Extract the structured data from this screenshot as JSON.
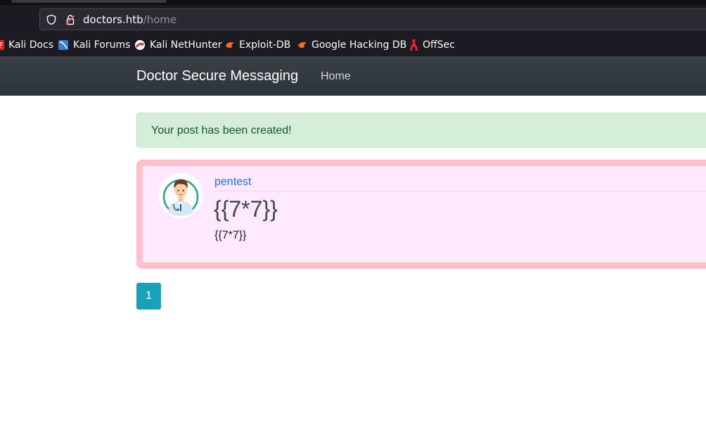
{
  "browser": {
    "url_host": "doctors.htb",
    "url_path": "/home",
    "bookmarks": [
      {
        "label": "Kali Docs",
        "icon": "kali-docs-icon"
      },
      {
        "label": "Kali Forums",
        "icon": "kali-forums-icon"
      },
      {
        "label": "Kali NetHunter",
        "icon": "kali-nethunter-icon"
      },
      {
        "label": "Exploit-DB",
        "icon": "exploit-db-icon"
      },
      {
        "label": "Google Hacking DB",
        "icon": "google-hacking-db-icon"
      },
      {
        "label": "OffSec",
        "icon": "offsec-icon"
      }
    ]
  },
  "navbar": {
    "brand": "Doctor Secure Messaging",
    "links": [
      "Home"
    ]
  },
  "alert": {
    "message": "Your post has been created!",
    "color": "#d4edda"
  },
  "post": {
    "author": "pentest",
    "title": "{{7*7}}",
    "content": "{{7*7}}",
    "avatar": "doctor-avatar-icon",
    "background": "#fde8fd",
    "border_color": "#ffc0cb"
  },
  "pagination": {
    "pages": [
      "1"
    ],
    "current": "1",
    "accent": "#17a2b8"
  }
}
